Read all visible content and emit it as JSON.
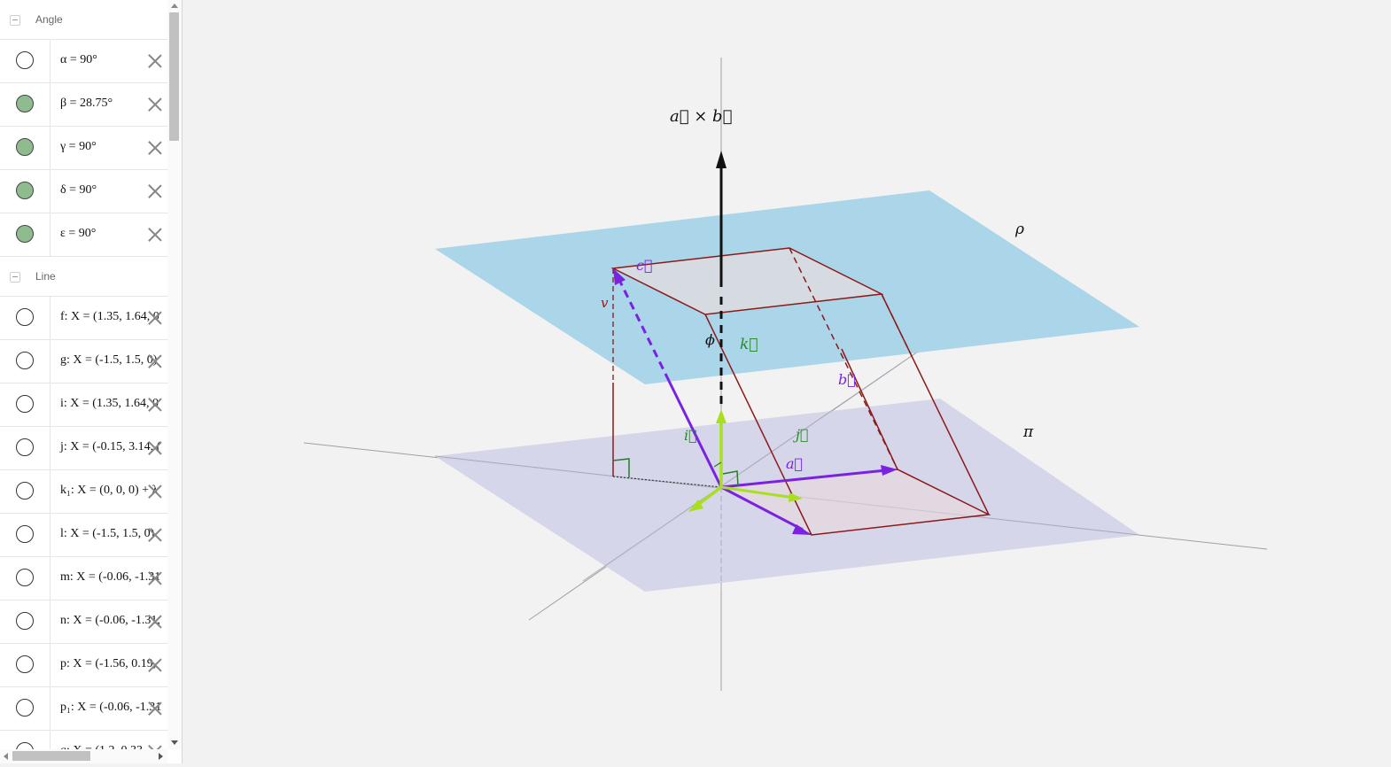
{
  "algebra": {
    "groups": [
      {
        "label": "Angle",
        "items": [
          {
            "expr": "α = 90°",
            "visible": false
          },
          {
            "expr": "β = 28.75°",
            "visible": true
          },
          {
            "expr": "γ = 90°",
            "visible": true
          },
          {
            "expr": "δ = 90°",
            "visible": true
          },
          {
            "expr": "ε = 90°",
            "visible": true
          }
        ]
      },
      {
        "label": "Line",
        "items": [
          {
            "expr": "f: X = (1.35, 1.64, 0",
            "visible": false
          },
          {
            "expr": "g: X = (-1.5, 1.5, 0)",
            "visible": false
          },
          {
            "expr": "i: X = (1.35, 1.64, 0",
            "visible": false
          },
          {
            "expr": "j: X = (-0.15, 3.14, (",
            "visible": false
          },
          {
            "expr": "k₁: X = (0, 0, 0) + λ",
            "visible": false
          },
          {
            "expr": "l: X = (-1.5, 1.5, 0)",
            "visible": false
          },
          {
            "expr": "m: X = (-0.06, -1.31",
            "visible": false
          },
          {
            "expr": "n: X = (-0.06, -1.31,",
            "visible": false
          },
          {
            "expr": "p: X = (-1.56, 0.19,",
            "visible": false
          },
          {
            "expr": "p₁: X = (-0.06, -1.31",
            "visible": false
          },
          {
            "expr": "q: X = (1.2, 0.33,",
            "visible": false
          }
        ]
      }
    ]
  },
  "graphics": {
    "labels": {
      "cross": "a⃗ × b⃗",
      "rho": "ρ",
      "pi": "π",
      "c": "c⃗",
      "v": "v",
      "phi": "ϕ",
      "k": "k⃗",
      "b": "b⃗",
      "i": "i⃗",
      "j": "j⃗",
      "a": "a⃗"
    },
    "colors": {
      "plane_rho": "#a6d3e8",
      "plane_pi": "#d4d4ea",
      "edge": "#8b1a1a",
      "vector": "#7a22e0",
      "unit": "#a8e020",
      "k_label": "#2a8a2a",
      "cross_arrow": "#111111"
    }
  }
}
